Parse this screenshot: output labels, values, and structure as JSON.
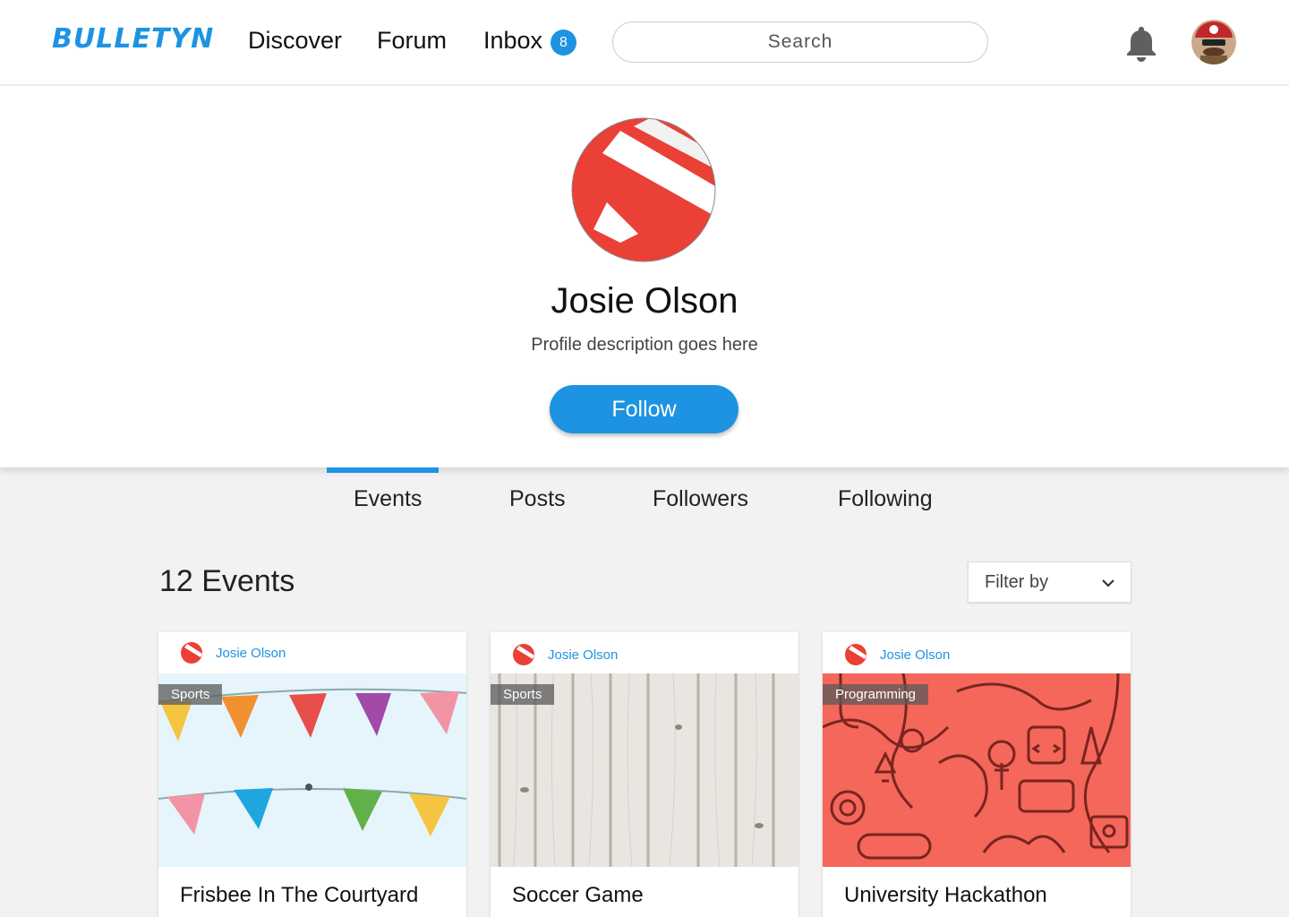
{
  "app": {
    "logo": "BULLETYN"
  },
  "nav": {
    "discover": "Discover",
    "forum": "Forum",
    "inbox": "Inbox",
    "inbox_badge": "8",
    "search_placeholder": "Search",
    "icons": [
      "bell-icon",
      "user-avatar"
    ]
  },
  "profile": {
    "name": "Josie Olson",
    "description": "Profile description goes here",
    "follow_label": "Follow"
  },
  "tabs": [
    {
      "label": "Events",
      "active": true
    },
    {
      "label": "Posts",
      "active": false
    },
    {
      "label": "Followers",
      "active": false
    },
    {
      "label": "Following",
      "active": false
    }
  ],
  "events": {
    "count_label": "12 Events",
    "filter_label": "Filter by"
  },
  "cards": [
    {
      "author": "Josie Olson",
      "tag": "Sports",
      "title": "Frisbee In The Courtyard",
      "image": "bunting-flags"
    },
    {
      "author": "Josie Olson",
      "tag": "Sports",
      "title": "Soccer Game",
      "image": "wood-planks"
    },
    {
      "author": "Josie Olson",
      "tag": "Programming",
      "title": "University Hackathon",
      "image": "doodle-pattern"
    }
  ],
  "colors": {
    "accent": "#1d93e2",
    "brand_red": "#ea3f35",
    "page_bg": "#f2f2f2"
  }
}
